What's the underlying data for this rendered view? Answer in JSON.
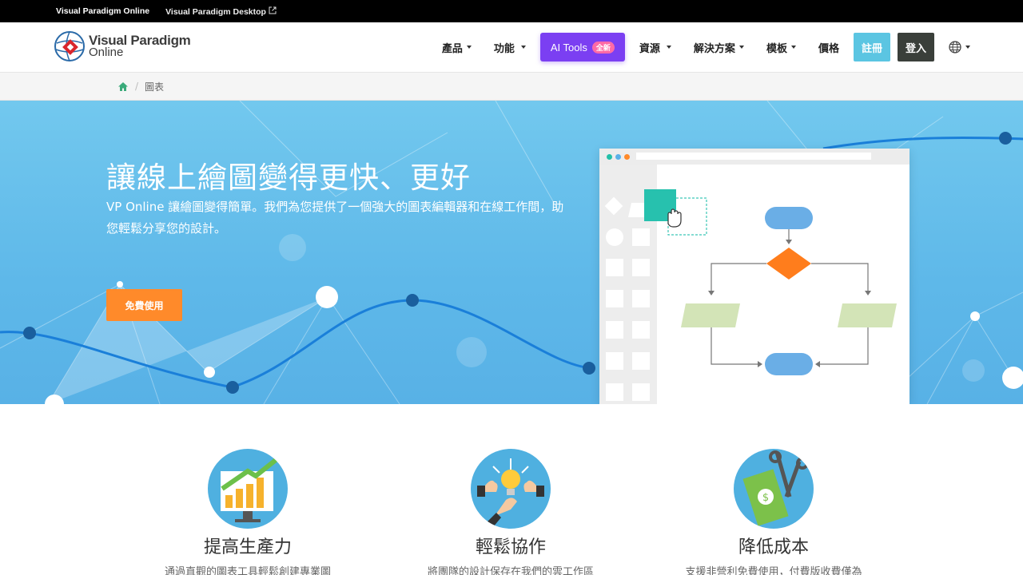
{
  "topbar": {
    "link1": "Visual Paradigm Online",
    "link2": "Visual Paradigm Desktop"
  },
  "logo": {
    "line1": "Visual Paradigm",
    "line2": "Online"
  },
  "nav": {
    "products": "產品",
    "features": "功能",
    "ai_tools": "AI Tools",
    "ai_badge": "全新",
    "resources": "資源",
    "solutions": "解決方案",
    "templates": "模板",
    "pricing": "價格",
    "register": "註冊",
    "login": "登入"
  },
  "breadcrumb": {
    "current": "圖表"
  },
  "hero": {
    "title": "讓線上繪圖變得更快、更好",
    "subtitle": "VP Online 讓繪圖變得簡單。我們為您提供了一個強大的圖表編輯器和在線工作間，助您輕鬆分享您的設計。",
    "cta": "免費使用"
  },
  "features": [
    {
      "title": "提高生產力",
      "desc": "通過直觀的圖表工具輕鬆創建專業圖"
    },
    {
      "title": "輕鬆協作",
      "desc": "將團隊的設計保存在我們的雲工作區"
    },
    {
      "title": "降低成本",
      "desc": "支援非營利免費使用，付費版收費僅為"
    }
  ],
  "colors": {
    "accent_purple": "#7b3ff2",
    "cta_orange": "#ff8a2a",
    "register_cyan": "#5bc5e2",
    "hero_blue": "#5eb8e9"
  },
  "icons": [
    "external-link-icon",
    "caret-down-icon",
    "globe-icon",
    "home-icon",
    "hand-cursor-icon",
    "growth-chart-icon",
    "collaboration-icon",
    "cost-cut-icon"
  ]
}
